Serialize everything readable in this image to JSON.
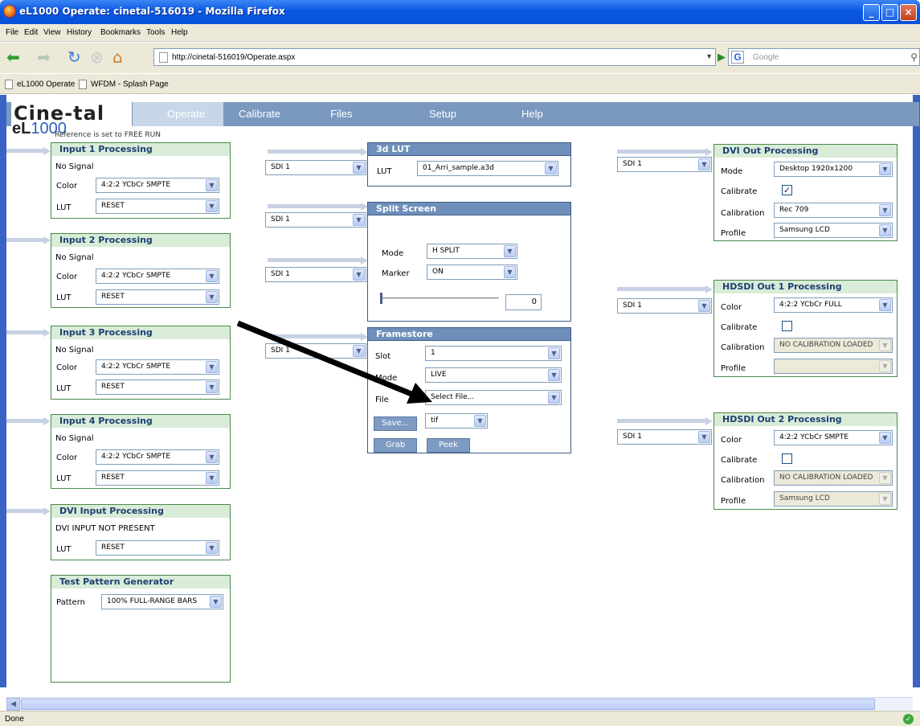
{
  "window": {
    "title": "eL1000 Operate: cinetal-516019 - Mozilla Firefox"
  },
  "menu": [
    "File",
    "Edit",
    "View",
    "History",
    "Bookmarks",
    "Tools",
    "Help"
  ],
  "address": {
    "url": "http://cinetal-516019/Operate.aspx"
  },
  "search": {
    "placeholder": "Google"
  },
  "bookmarks": [
    "eL1000 Operate",
    "WFDM - Splash Page"
  ],
  "logo": {
    "brand": "Cine-tal",
    "model_prefix": "eL",
    "model_number": "1000"
  },
  "tabs": [
    "Operate",
    "Calibrate",
    "Files",
    "Setup",
    "Help"
  ],
  "reference_note": "Reference is set to FREE RUN",
  "inputs": [
    {
      "title": "Input 1 Processing",
      "signal": "No Signal",
      "color_label": "Color",
      "color": "4:2:2 YCbCr SMPTE",
      "lut_label": "LUT",
      "lut": "RESET"
    },
    {
      "title": "Input 2 Processing",
      "signal": "No Signal",
      "color_label": "Color",
      "color": "4:2:2 YCbCr SMPTE",
      "lut_label": "LUT",
      "lut": "RESET"
    },
    {
      "title": "Input 3 Processing",
      "signal": "No Signal",
      "color_label": "Color",
      "color": "4:2:2 YCbCr SMPTE",
      "lut_label": "LUT",
      "lut": "RESET"
    },
    {
      "title": "Input 4 Processing",
      "signal": "No Signal",
      "color_label": "Color",
      "color": "4:2:2 YCbCr SMPTE",
      "lut_label": "LUT",
      "lut": "RESET"
    }
  ],
  "dvi_input": {
    "title": "DVI Input Processing",
    "signal": "DVI INPUT NOT PRESENT",
    "lut_label": "LUT",
    "lut": "RESET"
  },
  "test_pattern": {
    "title": "Test Pattern Generator",
    "pattern_label": "Pattern",
    "pattern": "100% FULL-RANGE BARS"
  },
  "sources": {
    "lut3d": "SDI 1",
    "split": "SDI 1",
    "split2": "SDI 1",
    "framestore": "SDI 1",
    "dvi_out": "SDI 1",
    "hdsdi1": "SDI 1",
    "hdsdi2": "SDI 1"
  },
  "lut3d": {
    "title": "3d LUT",
    "lut_label": "LUT",
    "lut": "01_Arri_sample.a3d"
  },
  "split_screen": {
    "title": "Split Screen",
    "mode_label": "Mode",
    "mode": "H SPLIT",
    "marker_label": "Marker",
    "marker": "ON",
    "value": "0"
  },
  "framestore": {
    "title": "Framestore",
    "slot_label": "Slot",
    "slot": "1",
    "mode_label": "Mode",
    "mode": "LIVE",
    "file_label": "File",
    "file": "Select File...",
    "save": "Save...",
    "format": "tif",
    "grab": "Grab",
    "peek": "Peek"
  },
  "dvi_out": {
    "title": "DVI Out Processing",
    "mode_label": "Mode",
    "mode": "Desktop 1920x1200",
    "calibrate_label": "Calibrate",
    "calibrate": true,
    "calibration_label": "Calibration",
    "calibration": "Rec 709",
    "profile_label": "Profile",
    "profile": "Samsung LCD"
  },
  "hdsdi1": {
    "title": "HDSDI Out 1 Processing",
    "color_label": "Color",
    "color": "4:2:2 YCbCr FULL",
    "calibrate_label": "Calibrate",
    "calibrate": false,
    "calibration_label": "Calibration",
    "calibration": "NO CALIBRATION LOADED",
    "profile_label": "Profile",
    "profile": ""
  },
  "hdsdi2": {
    "title": "HDSDI Out 2 Processing",
    "color_label": "Color",
    "color": "4:2:2 YCbCr SMPTE",
    "calibrate_label": "Calibrate",
    "calibrate": false,
    "calibration_label": "Calibration",
    "calibration": "NO CALIBRATION LOADED",
    "profile_label": "Profile",
    "profile": "Samsung LCD"
  },
  "status": {
    "text": "Done"
  },
  "icons": {
    "firefox": "firefox-icon",
    "back": "back-arrow-icon",
    "forward": "forward-arrow-icon",
    "reload": "reload-icon",
    "stop": "stop-icon",
    "home": "home-icon",
    "page": "page-icon",
    "go": "go-arrow-icon",
    "search": "search-icon",
    "ok": "ok-status-icon"
  },
  "colors": {
    "titlebar": "#0a58e3",
    "app_nav": "#7b99bf",
    "panel_green_border": "#4a8a4a",
    "panel_blue_header": "#6e8fb9",
    "panel_title": "#1c3f73"
  }
}
